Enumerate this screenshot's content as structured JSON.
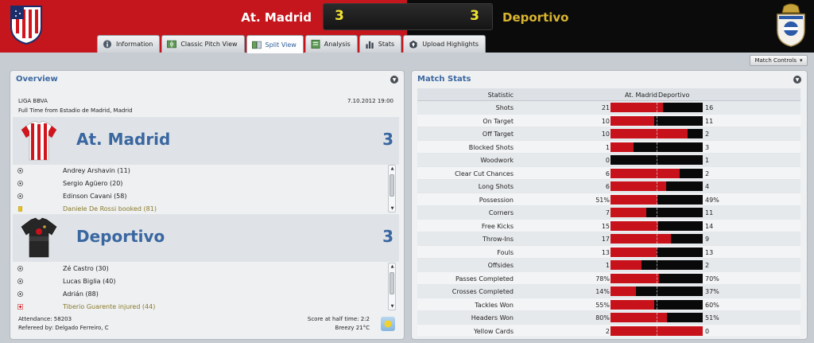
{
  "header": {
    "home_team": "At. Madrid",
    "away_team": "Deportivo",
    "home_score": "3",
    "away_score": "3"
  },
  "tabs": [
    {
      "label": "Information",
      "icon": "info-icon"
    },
    {
      "label": "Classic Pitch View",
      "icon": "pitch-icon"
    },
    {
      "label": "Split View",
      "icon": "split-view-icon",
      "active": true
    },
    {
      "label": "Analysis",
      "icon": "analysis-icon"
    },
    {
      "label": "Stats",
      "icon": "stats-icon"
    },
    {
      "label": "Upload Highlights",
      "icon": "upload-icon"
    }
  ],
  "toolbar": {
    "match_controls": "Match Controls"
  },
  "overview": {
    "title": "Overview",
    "league": "LIGA BBVA",
    "date": "7.10.2012 19:00",
    "venue": "Full Time from Estadio de Madrid, Madrid",
    "home": {
      "name": "At. Madrid",
      "score": "3",
      "events": [
        {
          "text": "Andrey Arshavin (11)",
          "type": "goal"
        },
        {
          "text": "Sergio Agüero (20)",
          "type": "goal"
        },
        {
          "text": "Edinson Cavani (58)",
          "type": "goal"
        },
        {
          "text": "Daniele De Rossi booked (81)",
          "type": "booking"
        }
      ]
    },
    "away": {
      "name": "Deportivo",
      "score": "3",
      "events": [
        {
          "text": "Zé Castro (30)",
          "type": "goal"
        },
        {
          "text": "Lucas Biglia (40)",
          "type": "goal"
        },
        {
          "text": "Adrián (88)",
          "type": "goal"
        },
        {
          "text": "Tiberio Guarente injured (44)",
          "type": "injury"
        }
      ]
    },
    "attendance": "Attendance: 58203",
    "referee": "Refereed by: Delgado Ferreiro, C",
    "halftime": "Score at half time: 2:2",
    "weather": "Breezy 21°C"
  },
  "match_stats": {
    "title": "Match Stats",
    "columns": {
      "statistic": "Statistic",
      "home": "At. Madrid",
      "away": "Deportivo"
    },
    "colors": {
      "home": "#c8121b",
      "away": "#090909"
    },
    "rows": [
      {
        "label": "Shots",
        "home": "21",
        "away": "16",
        "h": 21,
        "a": 16
      },
      {
        "label": "On Target",
        "home": "10",
        "away": "11",
        "h": 10,
        "a": 11
      },
      {
        "label": "Off Target",
        "home": "10",
        "away": "2",
        "h": 10,
        "a": 2
      },
      {
        "label": "Blocked Shots",
        "home": "1",
        "away": "3",
        "h": 1,
        "a": 3
      },
      {
        "label": "Woodwork",
        "home": "0",
        "away": "1",
        "h": 0,
        "a": 1
      },
      {
        "label": "Clear Cut Chances",
        "home": "6",
        "away": "2",
        "h": 6,
        "a": 2
      },
      {
        "label": "Long Shots",
        "home": "6",
        "away": "4",
        "h": 6,
        "a": 4
      },
      {
        "label": "Possession",
        "home": "51%",
        "away": "49%",
        "h": 51,
        "a": 49
      },
      {
        "label": "Corners",
        "home": "7",
        "away": "11",
        "h": 7,
        "a": 11
      },
      {
        "label": "Free Kicks",
        "home": "15",
        "away": "14",
        "h": 15,
        "a": 14
      },
      {
        "label": "Throw-Ins",
        "home": "17",
        "away": "9",
        "h": 17,
        "a": 9
      },
      {
        "label": "Fouls",
        "home": "13",
        "away": "13",
        "h": 13,
        "a": 13
      },
      {
        "label": "Offsides",
        "home": "1",
        "away": "2",
        "h": 1,
        "a": 2
      },
      {
        "label": "Passes Completed",
        "home": "78%",
        "away": "70%",
        "h": 78,
        "a": 70
      },
      {
        "label": "Crosses Completed",
        "home": "14%",
        "away": "37%",
        "h": 14,
        "a": 37
      },
      {
        "label": "Tackles Won",
        "home": "55%",
        "away": "60%",
        "h": 55,
        "a": 60
      },
      {
        "label": "Headers Won",
        "home": "80%",
        "away": "51%",
        "h": 80,
        "a": 51
      },
      {
        "label": "Yellow Cards",
        "home": "2",
        "away": "0",
        "h": 2,
        "a": 0
      }
    ]
  }
}
